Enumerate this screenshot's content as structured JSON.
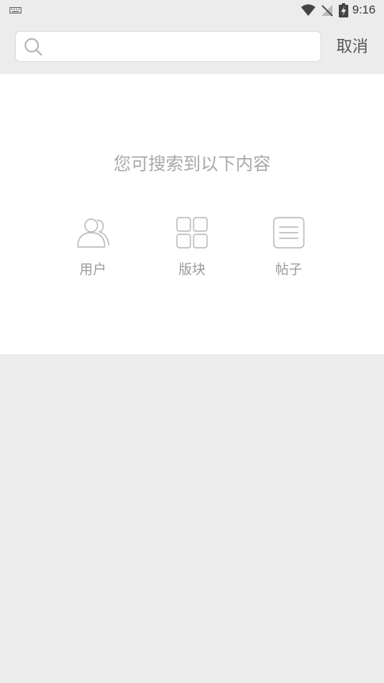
{
  "status_bar": {
    "time": "9:16",
    "icons": [
      "keyboard-icon",
      "wifi-icon",
      "no-signal-icon",
      "battery-charging-icon"
    ]
  },
  "search": {
    "placeholder": "",
    "value": "",
    "cancel_label": "取消"
  },
  "content": {
    "hint": "您可搜索到以下内容",
    "categories": [
      {
        "label": "用户",
        "icon": "users-icon"
      },
      {
        "label": "版块",
        "icon": "grid-icon"
      },
      {
        "label": "帖子",
        "icon": "document-icon"
      }
    ]
  },
  "colors": {
    "background": "#ececec",
    "panel": "#ffffff",
    "muted_text": "#9a9a9a"
  }
}
